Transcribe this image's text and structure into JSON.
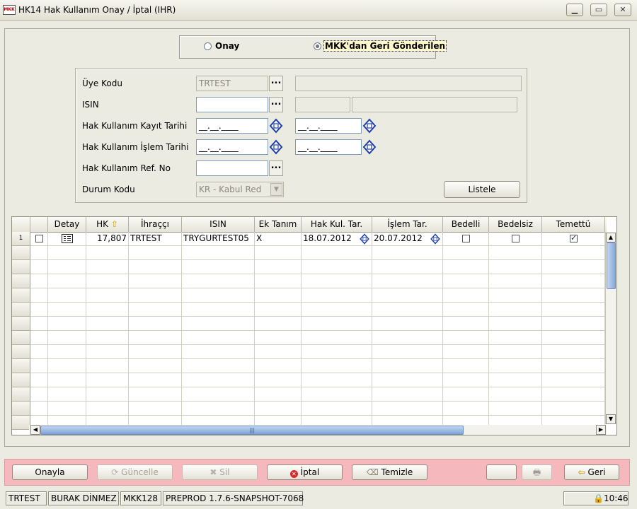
{
  "window": {
    "title": "HK14 Hak Kullanım Onay / İptal (IHR)",
    "icon_text": "MKK",
    "controls": [
      "minimize",
      "maximize",
      "close"
    ]
  },
  "mode": {
    "options": [
      {
        "label": "Onay",
        "selected": false
      },
      {
        "label": "MKK'dan Geri Gönderilen",
        "selected": true
      }
    ]
  },
  "filters": {
    "uye_kodu": {
      "label": "Üye Kodu",
      "value": "TRTEST",
      "name_value": ""
    },
    "isin": {
      "label": "ISIN",
      "value": "",
      "extra1": "",
      "extra2": ""
    },
    "kayit_tarihi": {
      "label": "Hak Kullanım Kayıt Tarihi",
      "from": "__.__.____",
      "to": "__.__.____"
    },
    "islem_tarihi": {
      "label": "Hak Kullanım İşlem Tarihi",
      "from": "__.__.____",
      "to": "__.__.____"
    },
    "ref_no": {
      "label": "Hak Kullanım Ref. No",
      "value": ""
    },
    "durum_kodu": {
      "label": "Durum Kodu",
      "value": "KR - Kabul Red"
    },
    "list_button": "Listele"
  },
  "grid": {
    "columns": [
      "",
      "Detay",
      "HK",
      "İhraççı",
      "ISIN",
      "Ek Tanım",
      "Hak Kul. Tar.",
      "İşlem Tar.",
      "Bedelli",
      "Bedelsiz",
      "Temettü"
    ],
    "sorted_column": "HK",
    "rows": [
      {
        "row_no": "1",
        "selected": false,
        "hk": "17,807",
        "ihracci": "TRTEST",
        "isin": "TRYGURTEST05",
        "ek_tanim": "X",
        "hak_kul_tar": "18.07.2012",
        "islem_tar": "20.07.2012",
        "bedelli": false,
        "bedelsiz": false,
        "temettu": true
      }
    ]
  },
  "actions": {
    "onayla": "Onayla",
    "guncelle": "Güncelle",
    "sil": "Sil",
    "iptal": "İptal",
    "temizle": "Temizle",
    "geri": "Geri"
  },
  "statusbar": {
    "member": "TRTEST",
    "user": "BURAK DİNMEZ",
    "code": "MKK128",
    "version": "PREPROD 1.7.6-SNAPSHOT-7068",
    "time": "10:46"
  },
  "colors": {
    "window_bg": "#ecebe1",
    "action_bar": "#f4b8bd",
    "scroll_thumb": "#86a9d9",
    "icon_blue": "#1f3fa8"
  }
}
